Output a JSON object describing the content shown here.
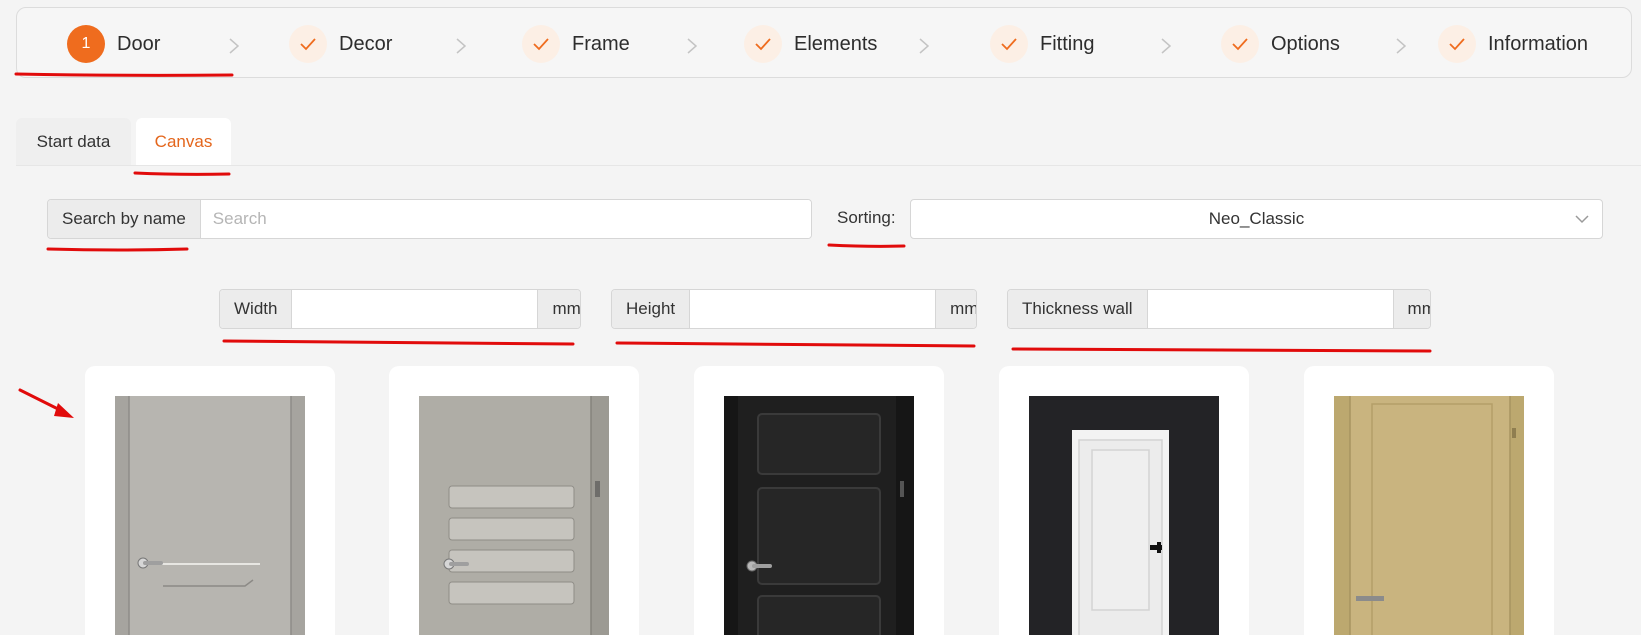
{
  "stepper": {
    "steps": [
      {
        "label": "Door",
        "number": "1",
        "state": "active"
      },
      {
        "label": "Decor",
        "state": "done"
      },
      {
        "label": "Frame",
        "state": "done"
      },
      {
        "label": "Elements",
        "state": "done"
      },
      {
        "label": "Fitting",
        "state": "done"
      },
      {
        "label": "Options",
        "state": "done"
      },
      {
        "label": "Information",
        "state": "done"
      }
    ]
  },
  "tabs": [
    {
      "label": "Start data",
      "active": false
    },
    {
      "label": "Canvas",
      "active": true
    }
  ],
  "search": {
    "label": "Search by name",
    "placeholder": "Search",
    "value": ""
  },
  "sorting": {
    "label": "Sorting",
    "colon": ":",
    "selected": "Neo_Classic"
  },
  "dimensions": {
    "width": {
      "label": "Width",
      "unit": "mm",
      "value": ""
    },
    "height": {
      "label": "Height",
      "unit": "mm",
      "value": ""
    },
    "thickness": {
      "label": "Thickness wall",
      "unit": "mm",
      "value": ""
    }
  },
  "doors": [
    {
      "name": "door-card-1",
      "color": "#b5b3ae"
    },
    {
      "name": "door-card-2",
      "color": "#b0aea7"
    },
    {
      "name": "door-card-3",
      "color": "#1f1f1f"
    },
    {
      "name": "door-card-4",
      "color": "#f2f2f2"
    },
    {
      "name": "door-card-5",
      "color": "#c9b37e"
    }
  ],
  "colors": {
    "accent": "#ef6c1e",
    "annotation": "#e10b0b"
  }
}
